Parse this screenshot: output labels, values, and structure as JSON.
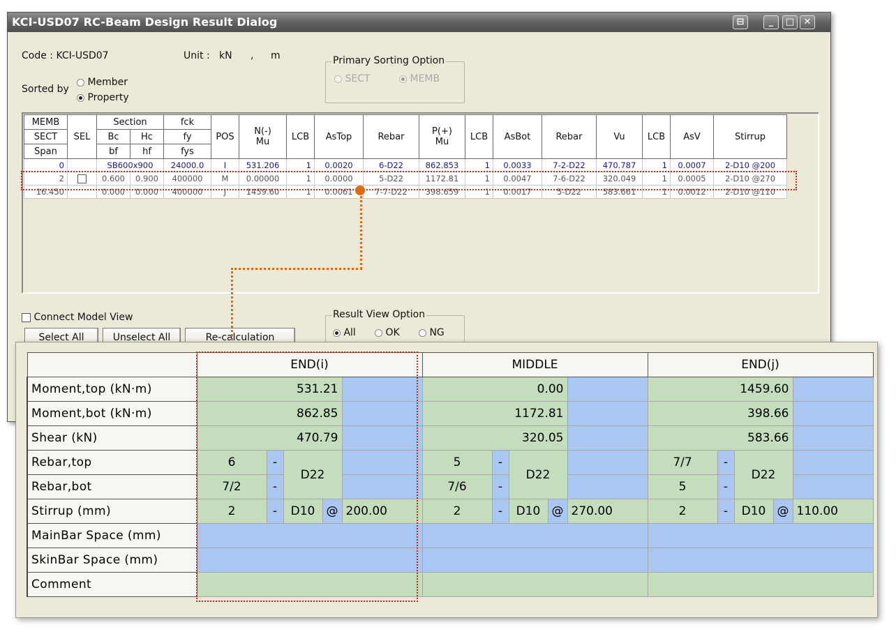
{
  "window": {
    "title": "KCI-USD07 RC-Beam Design Result Dialog",
    "title_buttons": [
      "⊟",
      "_",
      "□",
      "✕"
    ]
  },
  "header": {
    "code_label": "Code : KCI-USD07",
    "unit_label": "Unit :",
    "unit_force": "kN",
    "unit_sep": ",",
    "unit_length": "m",
    "sorted_by_label": "Sorted by",
    "sort_member": "Member",
    "sort_property": "Property",
    "sort_selected": "Property"
  },
  "primary_sorting": {
    "title": "Primary Sorting Option",
    "sect": "SECT",
    "memb": "MEMB",
    "selected": "MEMB"
  },
  "grid": {
    "headers": {
      "memb": "MEMB",
      "sect": "SECT",
      "span": "Span",
      "sel": "SEL",
      "section": "Section",
      "bc": "Bc",
      "hc": "Hc",
      "bf": "bf",
      "hf": "hf",
      "fck": "fck",
      "fy": "fy",
      "fys": "fys",
      "pos": "POS",
      "nmu_top": "N(-)",
      "nmu_bot": "Mu",
      "lcb": "LCB",
      "astop": "AsTop",
      "rebar": "Rebar",
      "pmu_top": "P(+)",
      "pmu_bot": "Mu",
      "asbot": "AsBot",
      "vu": "Vu",
      "asv": "AsV",
      "stirrup": "Stirrup"
    },
    "rows": [
      [
        "0",
        "",
        "SB600x900",
        "",
        "24000.0",
        "I",
        "531.206",
        "1",
        "0.0020",
        "6-D22",
        "862.853",
        "1",
        "0.0033",
        "7-2-D22",
        "470.787",
        "1",
        "0.0007",
        "2-D10 @200"
      ],
      [
        "2",
        "",
        "0.600",
        "0.900",
        "400000",
        "M",
        "0.00000",
        "1",
        "0.0000",
        "5-D22",
        "1172.81",
        "1",
        "0.0047",
        "7-6-D22",
        "320.049",
        "1",
        "0.0005",
        "2-D10 @270"
      ],
      [
        "16.450",
        "",
        "0.000",
        "0.000",
        "400000",
        "J",
        "1459.60",
        "1",
        "0.0061",
        "7-7-D22",
        "398.659",
        "1",
        "0.0017",
        "5-D22",
        "583.661",
        "1",
        "0.0012",
        "2-D10 @110"
      ]
    ]
  },
  "bottom": {
    "connect_label": "Connect Model View",
    "select_all": "Select All",
    "unselect_all": "Unselect All",
    "recalc": "Re-calculation"
  },
  "result_view": {
    "title": "Result View Option",
    "all": "All",
    "ok": "OK",
    "ng": "NG",
    "selected": "All"
  },
  "detail": {
    "headers": {
      "end_i": "END(i)",
      "middle": "MIDDLE",
      "end_j": "END(j)"
    },
    "labels": {
      "moment_top": "Moment,top (kN·m)",
      "moment_bot": "Moment,bot (kN·m)",
      "shear": "Shear (kN)",
      "rebar_top": "Rebar,top",
      "rebar_bot": "Rebar,bot",
      "stirrup": "Stirrup (mm)",
      "mainbar": "MainBar Space (mm)",
      "skinbar": "SkinBar Space (mm)",
      "comment": "Comment"
    },
    "end_i": {
      "moment_top": "531.21",
      "moment_bot": "862.85",
      "shear": "470.79",
      "rebar_top_n": "6",
      "rebar_bot_n": "7/2",
      "rebar_dash": "-",
      "rebar_dia": "D22",
      "stir_n": "2",
      "stir_dash": "-",
      "stir_dia": "D10",
      "stir_at": "@",
      "stir_space": "200.00"
    },
    "middle": {
      "moment_top": "0.00",
      "moment_bot": "1172.81",
      "shear": "320.05",
      "rebar_top_n": "5",
      "rebar_bot_n": "7/6",
      "rebar_dash": "-",
      "rebar_dia": "D22",
      "stir_n": "2",
      "stir_dash": "-",
      "stir_dia": "D10",
      "stir_at": "@",
      "stir_space": "270.00"
    },
    "end_j": {
      "moment_top": "1459.60",
      "moment_bot": "398.66",
      "shear": "583.66",
      "rebar_top_n": "7/7",
      "rebar_bot_n": "5",
      "rebar_dash": "-",
      "rebar_dia": "D22",
      "stir_n": "2",
      "stir_dash": "-",
      "stir_dia": "D10",
      "stir_at": "@",
      "stir_space": "110.00"
    }
  },
  "colors": {
    "green_cell": "#c3ddbd",
    "blue_cell": "#aac7f1",
    "highlight": "#c8281e",
    "callout": "#e06a14"
  }
}
